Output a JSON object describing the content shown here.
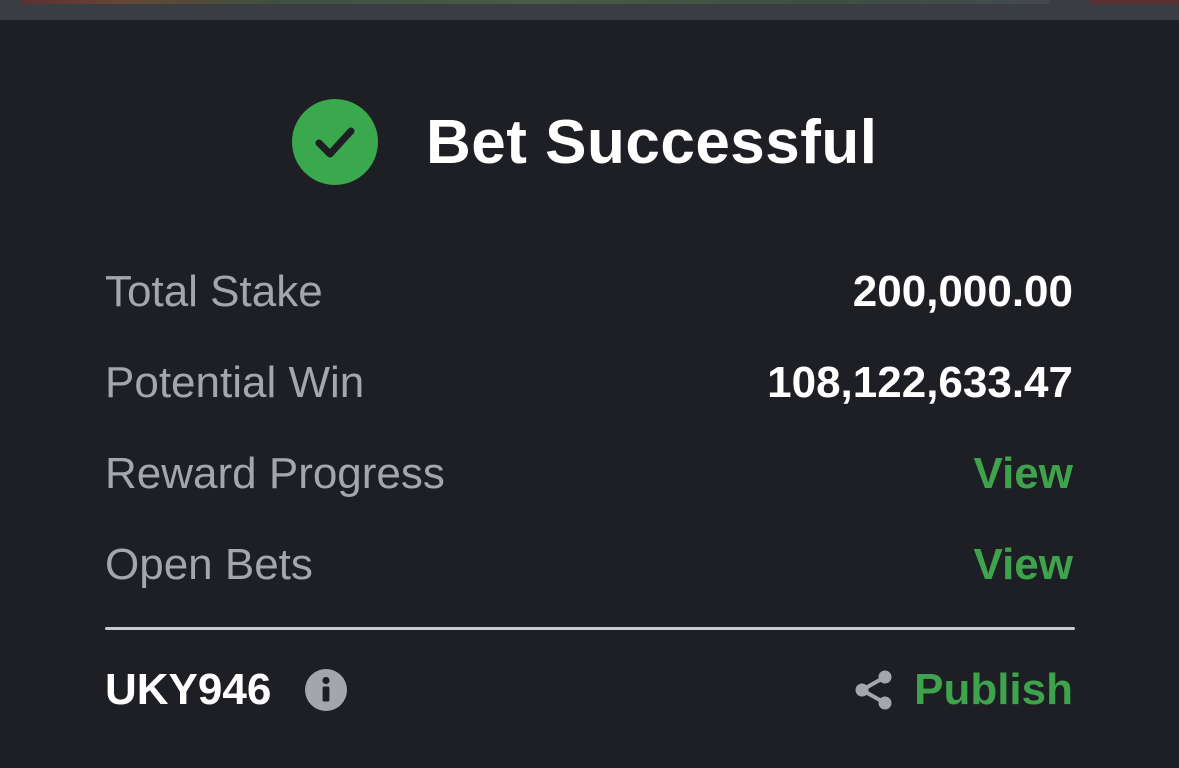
{
  "status": {
    "title": "Bet Successful",
    "icon": "check-circle-icon",
    "icon_color": "#3aa84c"
  },
  "summary": {
    "total_stake_label": "Total Stake",
    "total_stake_value": "200,000.00",
    "potential_win_label": "Potential Win",
    "potential_win_value": "108,122,633.47",
    "reward_progress_label": "Reward Progress",
    "reward_progress_link": "View",
    "open_bets_label": "Open Bets",
    "open_bets_link": "View"
  },
  "footer": {
    "ticket_id": "UKY946",
    "info_icon": "info-icon",
    "share_icon": "share-icon",
    "publish_label": "Publish"
  },
  "colors": {
    "background": "#1e1f24",
    "accent_green": "#3fa34d",
    "label_gray": "#a3a6ad",
    "value_white": "#ffffff"
  }
}
